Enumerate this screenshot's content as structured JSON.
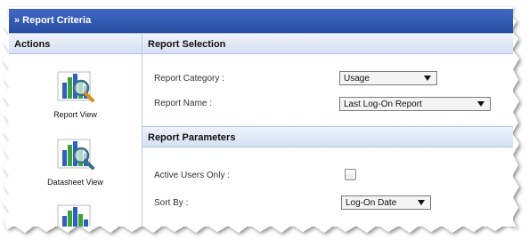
{
  "title_bar": {
    "text": "» Report Criteria"
  },
  "actions": {
    "heading": "Actions",
    "items": [
      {
        "label": "Report View",
        "icon": "report-chart-magnifier-icon"
      },
      {
        "label": "Datasheet View",
        "icon": "datasheet-chart-magnifier-icon"
      },
      {
        "label": "",
        "icon": "chart-icon"
      }
    ]
  },
  "report_selection": {
    "heading": "Report Selection",
    "category_label": "Report Category :",
    "category_value": "Usage",
    "name_label": "Report Name :",
    "name_value": "Last Log-On Report"
  },
  "report_parameters": {
    "heading": "Report Parameters",
    "active_users_label": "Active Users Only :",
    "active_users_checked": false,
    "sort_label": "Sort By :",
    "sort_value": "Log-On Date"
  },
  "colors": {
    "title_bar": "#2f56ad",
    "section_header": "#d5e0f2",
    "border": "#b4c5e2"
  }
}
